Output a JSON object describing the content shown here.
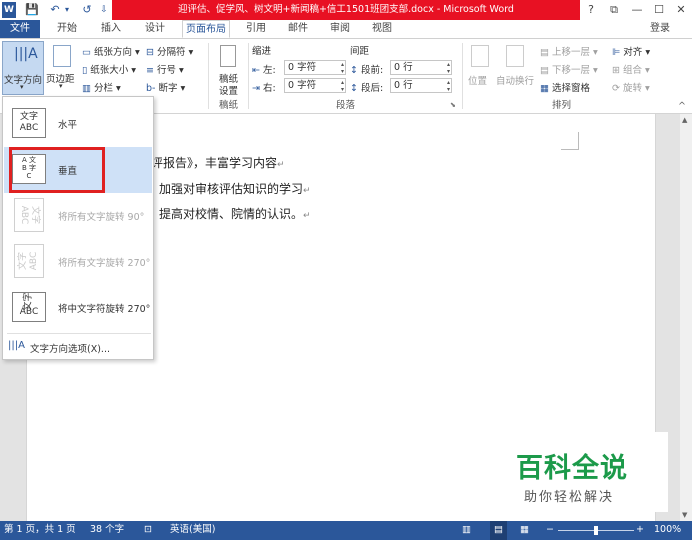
{
  "window": {
    "title": "迎评估、促学风、树文明+新闻稿+信工1501班团支部.docx - Microsoft Word",
    "help": "?",
    "restore_glyph": "⧉",
    "minimize_glyph": "—",
    "maximize_glyph": "☐",
    "close_glyph": "✕"
  },
  "quick_access": {
    "word_icon": "W",
    "save_icon": "💾",
    "undo_icon": "↶",
    "undo_dropdown": "▾",
    "redo_icon": "↺",
    "customize_icon": "⇩"
  },
  "tabs": [
    "文件",
    "开始",
    "插入",
    "设计",
    "页面布局",
    "引用",
    "邮件",
    "审阅",
    "视图"
  ],
  "login": "登录",
  "ribbon": {
    "text_direction": "文字方向",
    "margins": "页边距",
    "orientation": "纸张方向 ▾",
    "size": "纸张大小 ▾",
    "columns": "分栏 ▾",
    "breaks": "分隔符 ▾",
    "line_numbers": "行号 ▾",
    "hyphenation": "断字 ▾",
    "draft_line1": "稿纸",
    "draft_line2": "设置",
    "group_draft": "稿纸",
    "indent_header": "缩进",
    "spacing_header": "间距",
    "indent_left_label": "左:",
    "indent_left_value": "0 字符",
    "indent_right_label": "右:",
    "indent_right_value": "0 字符",
    "spacing_before_label": "段前:",
    "spacing_before_value": "0 行",
    "spacing_after_label": "段后:",
    "spacing_after_value": "0 行",
    "group_paragraph": "段落",
    "position": "位置",
    "wrap_text": "自动换行",
    "bring_forward": "上移一层 ▾",
    "send_backward": "下移一层 ▾",
    "selection_pane": "选择窗格",
    "align": "对齐 ▾",
    "group": "组合 ▾",
    "rotate": "旋转 ▾",
    "group_arrange": "排列",
    "collapse": "^"
  },
  "dropdown": {
    "items": [
      {
        "icon_text": "文字\nABC",
        "label": "水平",
        "enabled": true
      },
      {
        "icon_text": "文字\nABC",
        "label": "垂直",
        "enabled": true,
        "highlighted": true
      },
      {
        "icon_text": "文字\nABC",
        "label": "将所有文字旋转 90°",
        "enabled": false
      },
      {
        "icon_text": "文字\nABC",
        "label": "将所有文字旋转 270°",
        "enabled": false
      },
      {
        "icon_text": "文字\nABC",
        "label": "将中文字符旋转 270°",
        "enabled": true
      }
    ],
    "options_label": "文字方向选项(X)..."
  },
  "document": {
    "lines": [
      "评报告》，丰富学习内容",
      "加强对审核评估知识的学习",
      "提高对校情、院情的认识。"
    ],
    "paragraph_mark": "↵"
  },
  "watermark": {
    "title": "百科全说",
    "subtitle": "助你轻松解决"
  },
  "statusbar": {
    "page": "第 1 页，共 1 页",
    "words": "38 个字",
    "language": "英语(美国)",
    "zoom": "100%",
    "zoom_level": 1.0
  },
  "colors": {
    "accent": "#2b579a",
    "title_highlight": "#e81123",
    "annotation_box": "#e02020",
    "watermark_green": "#1c9a4a"
  }
}
